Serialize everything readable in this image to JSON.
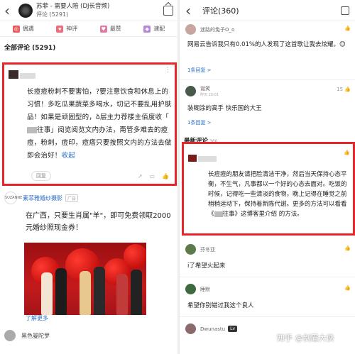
{
  "left": {
    "header": {
      "song_title": "苏菲 - 需要人陪 (DJ长音频)",
      "comment_count_label": "评论 (5291)"
    },
    "tabs": [
      {
        "label": "偶遇",
        "color": "#e85c5c"
      },
      {
        "label": "神评",
        "color": "#ea6d7e"
      },
      {
        "label": "最赞",
        "color": "#e07ba4"
      },
      {
        "label": "速配",
        "color": "#b588d8"
      }
    ],
    "all_comments_label": "全部评论 (5291)",
    "highlight_comment": {
      "text_1": "长痘痘粉刺不要害怕，?要注意饮食和休息上的习惯！多吃瓜果蔬菜多喝水，切记不要乱用护肤品！如果是顽固型的，ձ层主力荐楼主佰度收「",
      "text_2": "往事」阅览阅览文内办法，甭管多难去的痘痘，粉刺，痘印，痘痞只要按照文内的方法去做即会治好！",
      "collapse": "收起",
      "reply_label": "回复"
    },
    "ad": {
      "logo_text": "SUZANNE",
      "brand": "素菲雅婚纱摄影",
      "tag": "广告",
      "text": "在广西，只要生肖属\"羊\"，即可免费领取2000元婚纱照现金券！",
      "learn_more": "了解更多",
      "next_user": "黑色曼陀罗"
    }
  },
  "right": {
    "header": {
      "title": "评论(360)"
    },
    "comments": [
      {
        "user": "迷路的兔子O_o",
        "text": "网易云告诉我只有0.01%的人发现了这首歌让我去炫耀。😊",
        "reply": "1条回复 >",
        "likes": ""
      },
      {
        "user": "诞笑",
        "time": "昨天 20:01",
        "text": "装糊涂的高手 快乐国的大王",
        "reply": "1条回复 >",
        "likes": "15"
      }
    ],
    "latest_label": "最新评论",
    "latest_count": "360",
    "highlight_comment": {
      "text_1": "长痘痘的朋友请把脸清洁干净，然后当天保持心态平衡，不生气，凡事都以一个好的心态去面对。吃饭的时候，记得吃一些清淡的食物，晚上记得在睡觉之前稍稍运动下，保持着新陈代谢。更多的方法可以看看《",
      "text_2": "往事》这博客里介绍 的方法。"
    },
    "comments_bottom": [
      {
        "user": "芬冬亚",
        "text": "i了希望火起来"
      },
      {
        "user": "睡默",
        "text": "希望你别错过我这个良人"
      },
      {
        "user": "Dwunastu",
        "badge": "Lv",
        "text": ""
      }
    ]
  },
  "watermark": "知乎 @剑眉大侠"
}
